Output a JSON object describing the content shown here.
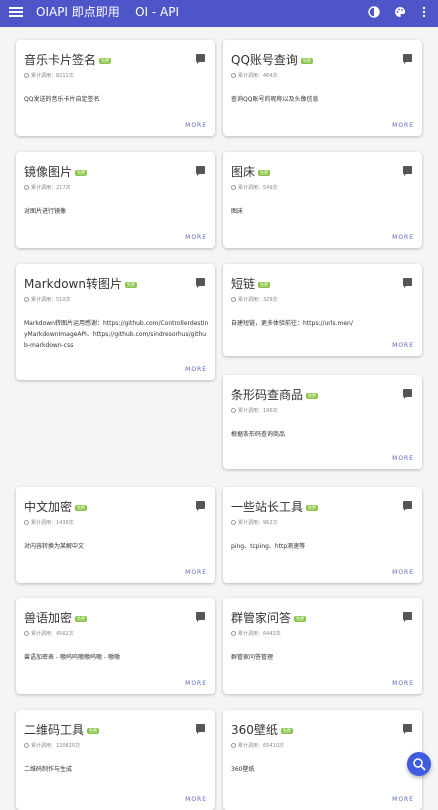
{
  "app": {
    "title": "OIAPI 即点即用",
    "subtitle": "OI - API"
  },
  "colors": {
    "appbar": "#4d55c9",
    "badge": "#8bc34a",
    "link": "#5c6bc0",
    "fab": "#3f5be0"
  },
  "left": [
    {
      "name": "音乐卡片签名",
      "badge": "免费",
      "count": "累计调用：8211次",
      "desc": "QQ发送的音乐卡片自定签名",
      "more": "MORE"
    },
    {
      "name": "镜像图片",
      "badge": "免费",
      "count": "累计调用：217次",
      "desc": "对图片进行镜像",
      "more": "MORE"
    },
    {
      "name": "Markdown转图片",
      "badge": "免费",
      "count": "累计调用：510次",
      "desc": "Markdown转图片运用感谢：https://github.com/ControllerdestinyMarkdownImageAPI、https://github.com/sindresorhus/github-markdown-css",
      "more": "MORE"
    },
    {
      "name": "中文加密",
      "badge": "免费",
      "count": "累计调用：1439次",
      "desc": "对内容转换为某解中文",
      "more": "MORE"
    },
    {
      "name": "兽语加密",
      "badge": "免费",
      "count": "累计调用：4562次",
      "desc": "兽语加密表 - 嗷呜呜嗷嗷呜嗷 - 嗷嗷",
      "more": "MORE"
    },
    {
      "name": "二维码工具",
      "badge": "免费",
      "count": "累计调用：120810次",
      "desc": "二维码制作与生成",
      "more": "MORE"
    }
  ],
  "right": [
    {
      "name": "QQ账号查询",
      "badge": "免费",
      "count": "累计调用：464次",
      "desc": "查询QQ账号的昵称以及头像信息",
      "more": "MORE"
    },
    {
      "name": "图床",
      "badge": "免费",
      "count": "累计调用：549次",
      "desc": "图床",
      "more": "MORE"
    },
    {
      "name": "短链",
      "badge": "免费",
      "count": "累计调用：329次",
      "desc": "自建短链，更多体验前往：https://urls.men/",
      "more": "MORE"
    },
    {
      "name": "条形码查商品",
      "badge": "免费",
      "count": "累计调用：196次",
      "desc": "根据条形码查询商品",
      "more": "MORE"
    },
    {
      "name": "一些站长工具",
      "badge": "免费",
      "count": "累计调用：962次",
      "desc": "ping、tcping、http测速等",
      "more": "MORE"
    },
    {
      "name": "群管家问答",
      "badge": "免费",
      "count": "累计调用：6442次",
      "desc": "群管家问答管理",
      "more": "MORE"
    },
    {
      "name": "360壁纸",
      "badge": "免费",
      "count": "累计调用：65410次",
      "desc": "360壁纸",
      "more": "MORE"
    }
  ]
}
